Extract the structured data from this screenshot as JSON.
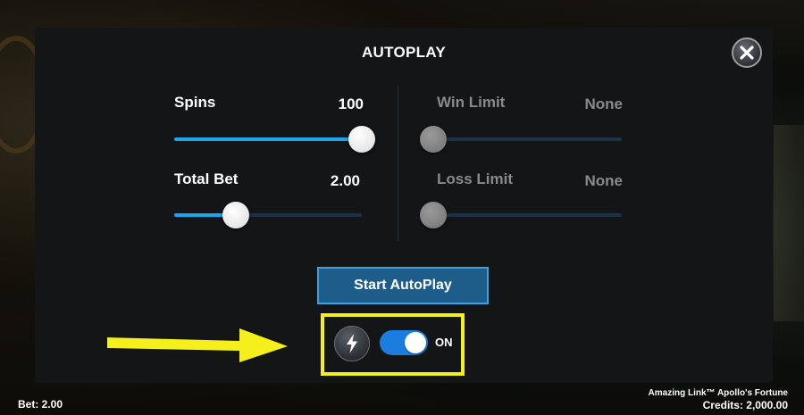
{
  "modal": {
    "title": "AUTOPLAY"
  },
  "left_panel": {
    "spins": {
      "label": "Spins",
      "value": "100",
      "slider_fraction": 1.0
    },
    "total_bet": {
      "label": "Total Bet",
      "value": "2.00",
      "slider_fraction": 0.33
    }
  },
  "right_panel": {
    "win_limit": {
      "label": "Win Limit",
      "value": "None",
      "slider_fraction": 0.0
    },
    "loss_limit": {
      "label": "Loss Limit",
      "value": "None",
      "slider_fraction": 0.0
    }
  },
  "start_button": {
    "label": "Start AutoPlay"
  },
  "turbo": {
    "icon": "lightning-bolt-icon",
    "toggle_state": "ON",
    "toggle_on": true
  },
  "footer": {
    "bet": "Bet: 2.00",
    "game_name": "Amazing Link™ Apollo's Fortune",
    "credits": "Credits: 2,000.00"
  },
  "colors": {
    "accent": "#1aa6e8",
    "toggle": "#1a7ee0",
    "highlight": "#f5ef1c",
    "button": "#1e5d8a"
  }
}
